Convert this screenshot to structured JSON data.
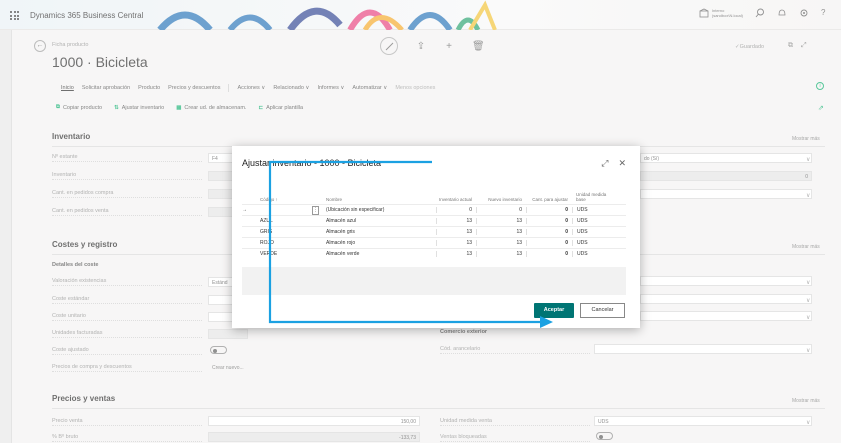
{
  "app": {
    "title": "Dynamics 365 Business Central"
  },
  "tenant": {
    "line1": "Interno",
    "line2": "(sandbox\\N.local)"
  },
  "header": {
    "breadcrumb": "Ficha producto",
    "title": "1000 · Bicicleta",
    "saved": "✓Guardado"
  },
  "actionbar": {
    "items": [
      "Inicio",
      "Solicitar aprobación",
      "Producto",
      "Precios y descuentos",
      "Acciones ∨",
      "Relacionado ∨",
      "Informes ∨",
      "Automatizar ∨",
      "Menos opciones"
    ],
    "promoted": [
      "Copiar producto",
      "Ajustar inventario",
      "Crear ud. de almacenam.",
      "Aplicar plantilla"
    ]
  },
  "inventario": {
    "title": "Inventario",
    "more": "Mostrar más",
    "fields": [
      "Nº estante",
      "Inventario",
      "Cant. en pedidos compra",
      "Cant. en pedidos venta"
    ],
    "shelf": "F4",
    "right_value": "do (Sí)",
    "right_num": "0"
  },
  "costes": {
    "title": "Costes y registro",
    "more": "Mostrar más",
    "sub": "Detalles del coste",
    "fields": [
      "Valoración existencias",
      "Coste estándar",
      "Coste unitario",
      "Unidades facturadas",
      "Coste ajustado",
      "Precios de compra y descuentos"
    ],
    "valuation": "Estánd",
    "create_new": "Crear nuevo...",
    "comercio": "Comercio exterior",
    "cod_arancelario": "Cód. arancelario"
  },
  "precios": {
    "title": "Precios y ventas",
    "more": "Mostrar más",
    "fields": [
      "Precio venta",
      "% Bº bruto"
    ],
    "precio_venta": "150,00",
    "bruto": "-133,73",
    "unidad_label": "Unidad medida venta",
    "unidad_value": "UDS",
    "bloqueadas_label": "Ventas bloqueadas"
  },
  "modal": {
    "title": "Ajustar inventario - 1000 - Bicicleta",
    "columns": [
      "Código ↑",
      "Nombre",
      "Inventario actual",
      "Nuevo inventario",
      "Cant. para ajustar",
      "Unidad medida base"
    ],
    "rows": [
      {
        "code": "",
        "name": "(Ubicación sin especificar)",
        "actual": "0",
        "nuevo": "0",
        "ajustar": "0",
        "unidad": "UDS"
      },
      {
        "code": "AZUL",
        "name": "Almacén azul",
        "actual": "13",
        "nuevo": "13",
        "ajustar": "0",
        "unidad": "UDS"
      },
      {
        "code": "GRIS",
        "name": "Almacén gris",
        "actual": "13",
        "nuevo": "13",
        "ajustar": "0",
        "unidad": "UDS"
      },
      {
        "code": "ROJO",
        "name": "Almacén rojo",
        "actual": "13",
        "nuevo": "13",
        "ajustar": "0",
        "unidad": "UDS"
      },
      {
        "code": "VERDE",
        "name": "Almacén verde",
        "actual": "13",
        "nuevo": "13",
        "ajustar": "0",
        "unidad": "UDS"
      }
    ],
    "ok": "Aceptar",
    "cancel": "Cancelar"
  },
  "colors": {
    "accent": "#007574",
    "arrow": "#1ba1e2"
  }
}
